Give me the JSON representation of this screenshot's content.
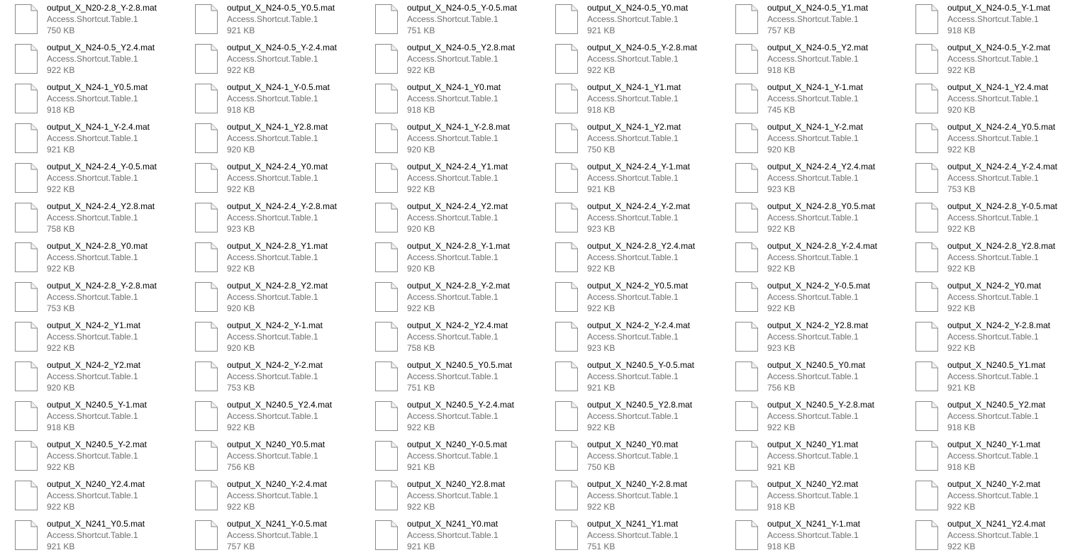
{
  "view": "tiles",
  "icon": "document-file-icon",
  "colors": {
    "name_text": "#000000",
    "detail_text": "#6d6d6d",
    "icon_stroke": "#8a8a8a",
    "background": "#ffffff"
  },
  "files": [
    {
      "name": "output_X_N20-2.8_Y-2.8.mat",
      "type": "Access.Shortcut.Table.1",
      "size": "750 KB"
    },
    {
      "name": "output_X_N24-0.5_Y0.5.mat",
      "type": "Access.Shortcut.Table.1",
      "size": "921 KB"
    },
    {
      "name": "output_X_N24-0.5_Y-0.5.mat",
      "type": "Access.Shortcut.Table.1",
      "size": "751 KB"
    },
    {
      "name": "output_X_N24-0.5_Y0.mat",
      "type": "Access.Shortcut.Table.1",
      "size": "921 KB"
    },
    {
      "name": "output_X_N24-0.5_Y1.mat",
      "type": "Access.Shortcut.Table.1",
      "size": "757 KB"
    },
    {
      "name": "output_X_N24-0.5_Y-1.mat",
      "type": "Access.Shortcut.Table.1",
      "size": "918 KB"
    },
    {
      "name": "output_X_N24-0.5_Y2.4.mat",
      "type": "Access.Shortcut.Table.1",
      "size": "922 KB"
    },
    {
      "name": "output_X_N24-0.5_Y-2.4.mat",
      "type": "Access.Shortcut.Table.1",
      "size": "922 KB"
    },
    {
      "name": "output_X_N24-0.5_Y2.8.mat",
      "type": "Access.Shortcut.Table.1",
      "size": "922 KB"
    },
    {
      "name": "output_X_N24-0.5_Y-2.8.mat",
      "type": "Access.Shortcut.Table.1",
      "size": "922 KB"
    },
    {
      "name": "output_X_N24-0.5_Y2.mat",
      "type": "Access.Shortcut.Table.1",
      "size": "918 KB"
    },
    {
      "name": "output_X_N24-0.5_Y-2.mat",
      "type": "Access.Shortcut.Table.1",
      "size": "922 KB"
    },
    {
      "name": "output_X_N24-1_Y0.5.mat",
      "type": "Access.Shortcut.Table.1",
      "size": "918 KB"
    },
    {
      "name": "output_X_N24-1_Y-0.5.mat",
      "type": "Access.Shortcut.Table.1",
      "size": "918 KB"
    },
    {
      "name": "output_X_N24-1_Y0.mat",
      "type": "Access.Shortcut.Table.1",
      "size": "918 KB"
    },
    {
      "name": "output_X_N24-1_Y1.mat",
      "type": "Access.Shortcut.Table.1",
      "size": "918 KB"
    },
    {
      "name": "output_X_N24-1_Y-1.mat",
      "type": "Access.Shortcut.Table.1",
      "size": "745 KB"
    },
    {
      "name": "output_X_N24-1_Y2.4.mat",
      "type": "Access.Shortcut.Table.1",
      "size": "920 KB"
    },
    {
      "name": "output_X_N24-1_Y-2.4.mat",
      "type": "Access.Shortcut.Table.1",
      "size": "921 KB"
    },
    {
      "name": "output_X_N24-1_Y2.8.mat",
      "type": "Access.Shortcut.Table.1",
      "size": "920 KB"
    },
    {
      "name": "output_X_N24-1_Y-2.8.mat",
      "type": "Access.Shortcut.Table.1",
      "size": "920 KB"
    },
    {
      "name": "output_X_N24-1_Y2.mat",
      "type": "Access.Shortcut.Table.1",
      "size": "750 KB"
    },
    {
      "name": "output_X_N24-1_Y-2.mat",
      "type": "Access.Shortcut.Table.1",
      "size": "920 KB"
    },
    {
      "name": "output_X_N24-2.4_Y0.5.mat",
      "type": "Access.Shortcut.Table.1",
      "size": "922 KB"
    },
    {
      "name": "output_X_N24-2.4_Y-0.5.mat",
      "type": "Access.Shortcut.Table.1",
      "size": "922 KB"
    },
    {
      "name": "output_X_N24-2.4_Y0.mat",
      "type": "Access.Shortcut.Table.1",
      "size": "922 KB"
    },
    {
      "name": "output_X_N24-2.4_Y1.mat",
      "type": "Access.Shortcut.Table.1",
      "size": "922 KB"
    },
    {
      "name": "output_X_N24-2.4_Y-1.mat",
      "type": "Access.Shortcut.Table.1",
      "size": "921 KB"
    },
    {
      "name": "output_X_N24-2.4_Y2.4.mat",
      "type": "Access.Shortcut.Table.1",
      "size": "923 KB"
    },
    {
      "name": "output_X_N24-2.4_Y-2.4.mat",
      "type": "Access.Shortcut.Table.1",
      "size": "753 KB"
    },
    {
      "name": "output_X_N24-2.4_Y2.8.mat",
      "type": "Access.Shortcut.Table.1",
      "size": "758 KB"
    },
    {
      "name": "output_X_N24-2.4_Y-2.8.mat",
      "type": "Access.Shortcut.Table.1",
      "size": "923 KB"
    },
    {
      "name": "output_X_N24-2.4_Y2.mat",
      "type": "Access.Shortcut.Table.1",
      "size": "920 KB"
    },
    {
      "name": "output_X_N24-2.4_Y-2.mat",
      "type": "Access.Shortcut.Table.1",
      "size": "923 KB"
    },
    {
      "name": "output_X_N24-2.8_Y0.5.mat",
      "type": "Access.Shortcut.Table.1",
      "size": "922 KB"
    },
    {
      "name": "output_X_N24-2.8_Y-0.5.mat",
      "type": "Access.Shortcut.Table.1",
      "size": "922 KB"
    },
    {
      "name": "output_X_N24-2.8_Y0.mat",
      "type": "Access.Shortcut.Table.1",
      "size": "922 KB"
    },
    {
      "name": "output_X_N24-2.8_Y1.mat",
      "type": "Access.Shortcut.Table.1",
      "size": "922 KB"
    },
    {
      "name": "output_X_N24-2.8_Y-1.mat",
      "type": "Access.Shortcut.Table.1",
      "size": "920 KB"
    },
    {
      "name": "output_X_N24-2.8_Y2.4.mat",
      "type": "Access.Shortcut.Table.1",
      "size": "922 KB"
    },
    {
      "name": "output_X_N24-2.8_Y-2.4.mat",
      "type": "Access.Shortcut.Table.1",
      "size": "922 KB"
    },
    {
      "name": "output_X_N24-2.8_Y2.8.mat",
      "type": "Access.Shortcut.Table.1",
      "size": "922 KB"
    },
    {
      "name": "output_X_N24-2.8_Y-2.8.mat",
      "type": "Access.Shortcut.Table.1",
      "size": "753 KB"
    },
    {
      "name": "output_X_N24-2.8_Y2.mat",
      "type": "Access.Shortcut.Table.1",
      "size": "920 KB"
    },
    {
      "name": "output_X_N24-2.8_Y-2.mat",
      "type": "Access.Shortcut.Table.1",
      "size": "922 KB"
    },
    {
      "name": "output_X_N24-2_Y0.5.mat",
      "type": "Access.Shortcut.Table.1",
      "size": "922 KB"
    },
    {
      "name": "output_X_N24-2_Y-0.5.mat",
      "type": "Access.Shortcut.Table.1",
      "size": "922 KB"
    },
    {
      "name": "output_X_N24-2_Y0.mat",
      "type": "Access.Shortcut.Table.1",
      "size": "922 KB"
    },
    {
      "name": "output_X_N24-2_Y1.mat",
      "type": "Access.Shortcut.Table.1",
      "size": "922 KB"
    },
    {
      "name": "output_X_N24-2_Y-1.mat",
      "type": "Access.Shortcut.Table.1",
      "size": "920 KB"
    },
    {
      "name": "output_X_N24-2_Y2.4.mat",
      "type": "Access.Shortcut.Table.1",
      "size": "758 KB"
    },
    {
      "name": "output_X_N24-2_Y-2.4.mat",
      "type": "Access.Shortcut.Table.1",
      "size": "923 KB"
    },
    {
      "name": "output_X_N24-2_Y2.8.mat",
      "type": "Access.Shortcut.Table.1",
      "size": "923 KB"
    },
    {
      "name": "output_X_N24-2_Y-2.8.mat",
      "type": "Access.Shortcut.Table.1",
      "size": "922 KB"
    },
    {
      "name": "output_X_N24-2_Y2.mat",
      "type": "Access.Shortcut.Table.1",
      "size": "920 KB"
    },
    {
      "name": "output_X_N24-2_Y-2.mat",
      "type": "Access.Shortcut.Table.1",
      "size": "753 KB"
    },
    {
      "name": "output_X_N240.5_Y0.5.mat",
      "type": "Access.Shortcut.Table.1",
      "size": "751 KB"
    },
    {
      "name": "output_X_N240.5_Y-0.5.mat",
      "type": "Access.Shortcut.Table.1",
      "size": "921 KB"
    },
    {
      "name": "output_X_N240.5_Y0.mat",
      "type": "Access.Shortcut.Table.1",
      "size": "756 KB"
    },
    {
      "name": "output_X_N240.5_Y1.mat",
      "type": "Access.Shortcut.Table.1",
      "size": "921 KB"
    },
    {
      "name": "output_X_N240.5_Y-1.mat",
      "type": "Access.Shortcut.Table.1",
      "size": "918 KB"
    },
    {
      "name": "output_X_N240.5_Y2.4.mat",
      "type": "Access.Shortcut.Table.1",
      "size": "922 KB"
    },
    {
      "name": "output_X_N240.5_Y-2.4.mat",
      "type": "Access.Shortcut.Table.1",
      "size": "922 KB"
    },
    {
      "name": "output_X_N240.5_Y2.8.mat",
      "type": "Access.Shortcut.Table.1",
      "size": "922 KB"
    },
    {
      "name": "output_X_N240.5_Y-2.8.mat",
      "type": "Access.Shortcut.Table.1",
      "size": "922 KB"
    },
    {
      "name": "output_X_N240.5_Y2.mat",
      "type": "Access.Shortcut.Table.1",
      "size": "918 KB"
    },
    {
      "name": "output_X_N240.5_Y-2.mat",
      "type": "Access.Shortcut.Table.1",
      "size": "922 KB"
    },
    {
      "name": "output_X_N240_Y0.5.mat",
      "type": "Access.Shortcut.Table.1",
      "size": "756 KB"
    },
    {
      "name": "output_X_N240_Y-0.5.mat",
      "type": "Access.Shortcut.Table.1",
      "size": "921 KB"
    },
    {
      "name": "output_X_N240_Y0.mat",
      "type": "Access.Shortcut.Table.1",
      "size": "750 KB"
    },
    {
      "name": "output_X_N240_Y1.mat",
      "type": "Access.Shortcut.Table.1",
      "size": "921 KB"
    },
    {
      "name": "output_X_N240_Y-1.mat",
      "type": "Access.Shortcut.Table.1",
      "size": "918 KB"
    },
    {
      "name": "output_X_N240_Y2.4.mat",
      "type": "Access.Shortcut.Table.1",
      "size": "922 KB"
    },
    {
      "name": "output_X_N240_Y-2.4.mat",
      "type": "Access.Shortcut.Table.1",
      "size": "922 KB"
    },
    {
      "name": "output_X_N240_Y2.8.mat",
      "type": "Access.Shortcut.Table.1",
      "size": "922 KB"
    },
    {
      "name": "output_X_N240_Y-2.8.mat",
      "type": "Access.Shortcut.Table.1",
      "size": "922 KB"
    },
    {
      "name": "output_X_N240_Y2.mat",
      "type": "Access.Shortcut.Table.1",
      "size": "918 KB"
    },
    {
      "name": "output_X_N240_Y-2.mat",
      "type": "Access.Shortcut.Table.1",
      "size": "922 KB"
    },
    {
      "name": "output_X_N241_Y0.5.mat",
      "type": "Access.Shortcut.Table.1",
      "size": "921 KB"
    },
    {
      "name": "output_X_N241_Y-0.5.mat",
      "type": "Access.Shortcut.Table.1",
      "size": "757 KB"
    },
    {
      "name": "output_X_N241_Y0.mat",
      "type": "Access.Shortcut.Table.1",
      "size": "921 KB"
    },
    {
      "name": "output_X_N241_Y1.mat",
      "type": "Access.Shortcut.Table.1",
      "size": "751 KB"
    },
    {
      "name": "output_X_N241_Y-1.mat",
      "type": "Access.Shortcut.Table.1",
      "size": "918 KB"
    },
    {
      "name": "output_X_N241_Y2.4.mat",
      "type": "Access.Shortcut.Table.1",
      "size": "922 KB"
    }
  ]
}
